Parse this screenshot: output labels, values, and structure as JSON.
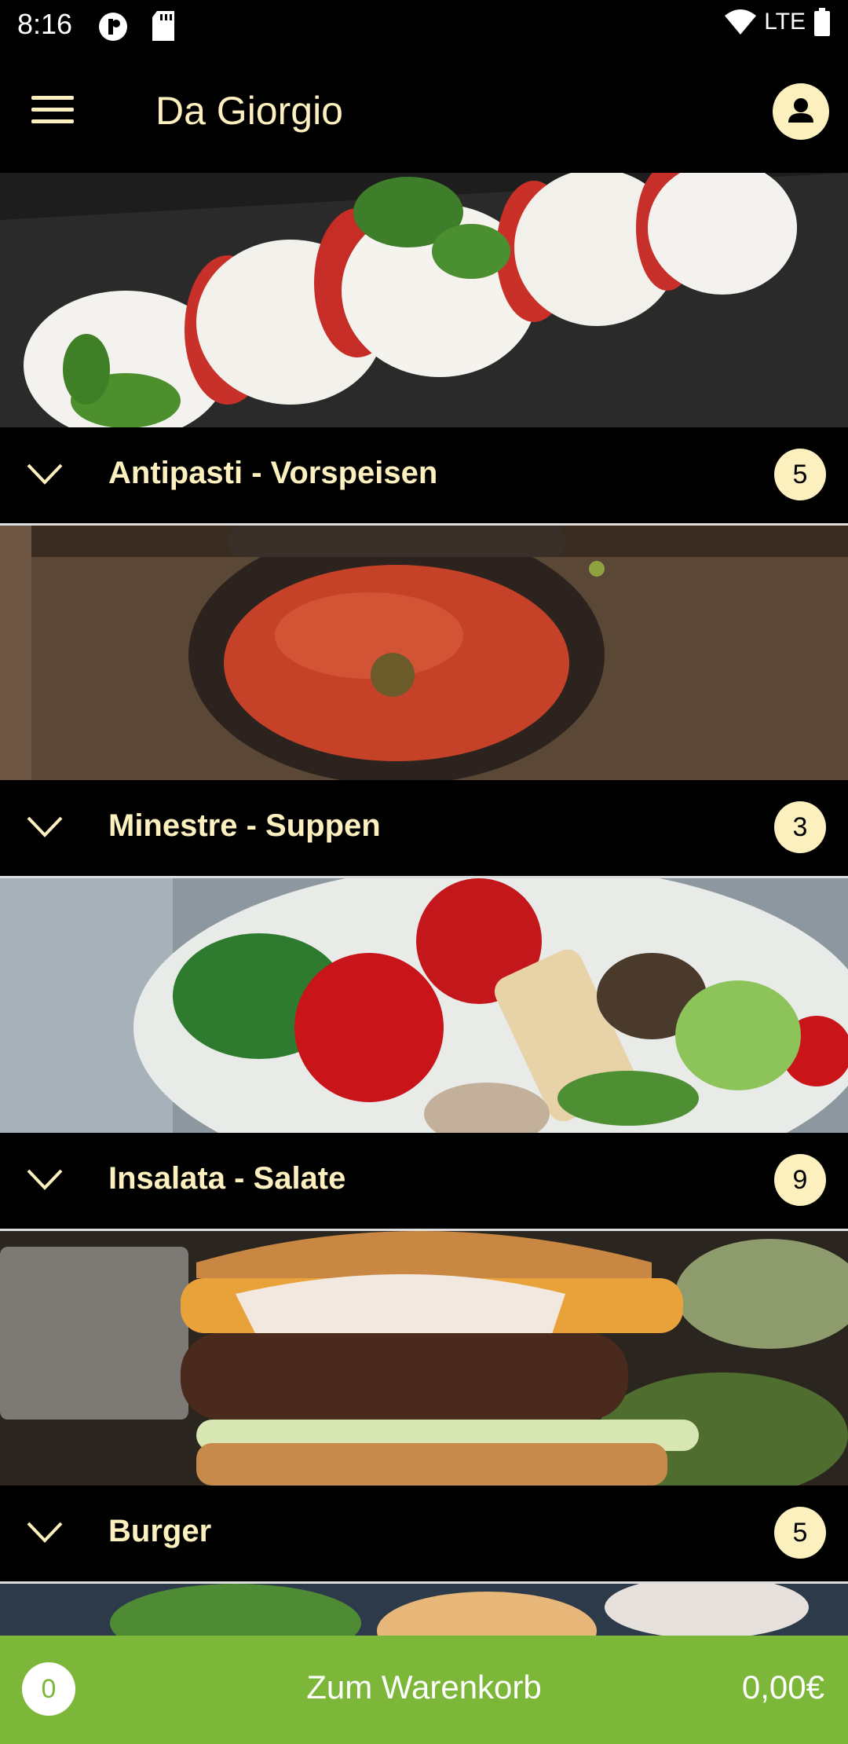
{
  "status_bar": {
    "time": "8:16",
    "network": "LTE"
  },
  "app_bar": {
    "title": "Da Giorgio"
  },
  "categories": [
    {
      "name": "Antipasti - Vorspeisen",
      "count": "5"
    },
    {
      "name": "Minestre - Suppen",
      "count": "3"
    },
    {
      "name": "Insalata - Salate",
      "count": "9"
    },
    {
      "name": "Burger",
      "count": "5"
    }
  ],
  "cart": {
    "count": "0",
    "label": "Zum Warenkorb",
    "total": "0,00€"
  },
  "colors": {
    "accent": "#fdf0bf",
    "cart": "#7cb73a",
    "background": "#000000"
  }
}
